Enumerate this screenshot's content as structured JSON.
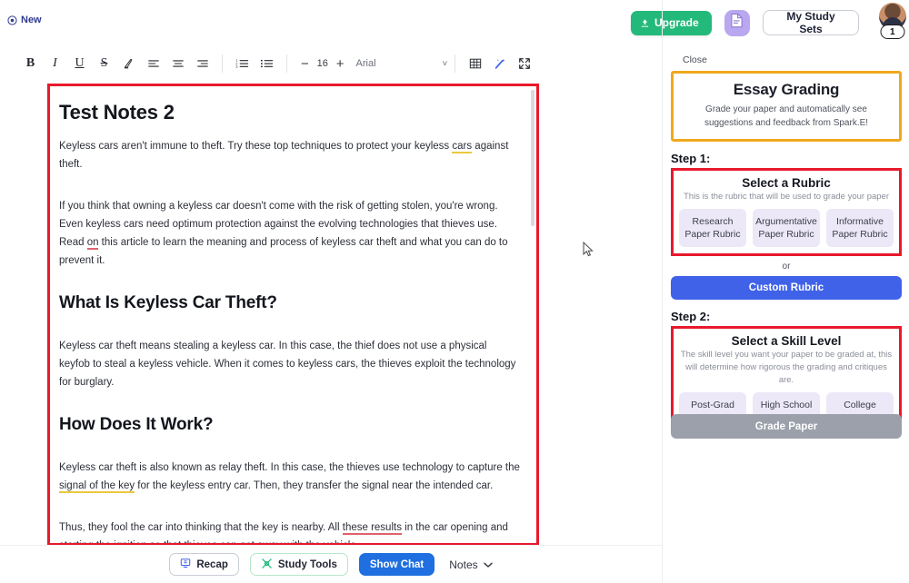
{
  "header": {
    "new_label": "New",
    "upgrade_label": "Upgrade",
    "study_sets_label": "My Study Sets",
    "avatar_badge": "1"
  },
  "toolbar": {
    "bold": "B",
    "italic": "I",
    "underline": "U",
    "strikethrough": "S",
    "highlight": "highlighter-icon",
    "align_left": "align-left-icon",
    "align_center": "align-center-icon",
    "align_right": "align-right-icon",
    "ordered_list": "ordered-list-icon",
    "bullet_list": "bullet-list-icon",
    "decrease": "−",
    "font_size": "16",
    "increase": "+",
    "font_family": "Arial",
    "caret": "˅",
    "table": "table-icon",
    "magic": "magic-wand-icon",
    "fullscreen": "fullscreen-icon"
  },
  "document": {
    "title": "Test Notes 2",
    "blocks": [
      {
        "type": "p",
        "html": "Keyless cars aren't immune to theft. Try these top techniques to protect your keyless <span class=\"hl-y\">cars</span> against theft."
      },
      {
        "type": "p",
        "html": "If you think that owning a keyless car doesn't come with the risk of getting stolen, you're wrong. Even keyless cars need optimum protection against the evolving technologies that thieves use. Read <span class=\"hl-r\">on</span> this article to learn the meaning and process of keyless car theft and what you can do to prevent it."
      },
      {
        "type": "h2",
        "html": "What Is Keyless Car Theft?"
      },
      {
        "type": "p",
        "html": "Keyless car theft means stealing a keyless car. In this case, the thief does not use a physical keyfob to steal a keyless vehicle. When it comes to keyless cars, the thieves exploit the technology for burglary."
      },
      {
        "type": "h2",
        "html": "How Does It Work?"
      },
      {
        "type": "p",
        "html": "Keyless car theft is also known as relay theft. In this case, the thieves use technology to capture the <span class=\"hl-y\">signal of the key</span> for the keyless entry car. Then, they transfer the signal near the intended car."
      },
      {
        "type": "p",
        "html": "Thus, they fool the car into thinking that the key is nearby. All <span class=\"hl-r\">these results</span> in the car opening and starting the ignition so that thieves can get away with the vehicle."
      }
    ]
  },
  "bottom_bar": {
    "recap_label": "Recap",
    "study_tools_label": "Study Tools",
    "show_chat_label": "Show Chat",
    "notes_label": "Notes"
  },
  "panel": {
    "close_label": "Close",
    "card_title": "Essay Grading",
    "card_subtitle": "Grade your paper and automatically see suggestions and feedback from Spark.E!",
    "step1_label": "Step 1:",
    "rubric": {
      "title": "Select a Rubric",
      "description": "This is the rubric that will be used to grade your paper",
      "options": [
        "Research Paper Rubric",
        "Argumentative Paper Rubric",
        "Informative Paper Rubric"
      ],
      "or_label": "or",
      "custom_label": "Custom Rubric"
    },
    "step2_label": "Step 2:",
    "skill": {
      "title": "Select a Skill Level",
      "description": "The skill level you want your paper to be graded at, this will determine how rigorous the grading and critiques are.",
      "options": [
        "Post-Grad",
        "High School",
        "College"
      ]
    },
    "grade_label": "Grade Paper"
  },
  "colors": {
    "annotation_red": "#e8192c",
    "annotation_orange": "#f0a81d",
    "accent_blue": "#3f62e8",
    "upgrade_green": "#23b97a",
    "chip_lavender": "#ece8f8",
    "disabled_gray": "#9ba0ab"
  }
}
